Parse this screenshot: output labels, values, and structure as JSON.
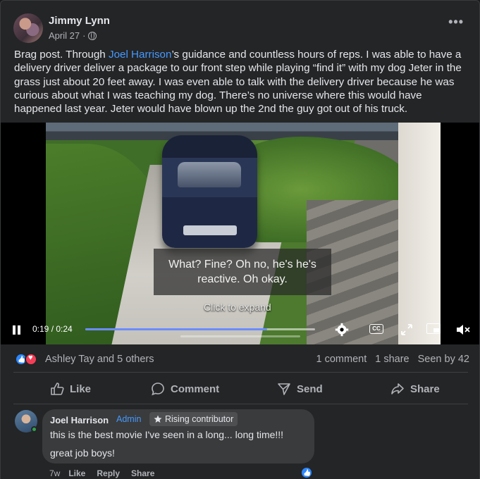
{
  "post": {
    "author": "Jimmy Lynn",
    "date": "April 27",
    "date_separator": "·",
    "text_before_mention": "Brag post. Through ",
    "mention": "Joel Harrison",
    "text_after_mention": "’s guidance and countless hours of reps. I was able to have a delivery driver deliver a package to our front step while playing “find it” with my dog Jeter in the grass just about 20 feet away. I was even able to talk with the delivery driver because he was curious about what I was teaching my dog. There’s no universe where this would have happened last year. Jeter would have blown up the 2nd the guy got out of his truck.",
    "more_icon": "more-horizontal-icon",
    "privacy_icon": "globe-icon"
  },
  "video": {
    "subtitle_line1": "What? Fine? Oh no, he's he's",
    "subtitle_line2": "reactive. Oh okay.",
    "expand_hint": "Click to expand",
    "current_time": "0:19",
    "time_separator": " / ",
    "duration": "0:24",
    "progress_fraction": 0.79,
    "cc_label": "CC",
    "accent_color": "#6c8cff"
  },
  "reactions": {
    "names": "Ashley Tay and 5 others",
    "comments": "1 comment",
    "shares": "1 share",
    "seen_by": "Seen by 42"
  },
  "actions": {
    "like": "Like",
    "comment": "Comment",
    "send": "Send",
    "share": "Share"
  },
  "comment": {
    "author": "Joel Harrison",
    "role": "Admin",
    "badge": "Rising contributor",
    "line1": "this is the best movie I've seen in a long... long time!!!",
    "line2": "great job boys!",
    "time_ago": "7w",
    "like": "Like",
    "reply": "Reply",
    "share": "Share"
  },
  "colors": {
    "background": "#242526",
    "link": "#4599ff",
    "like_blue": "#2d88ff",
    "love_red": "#f33e58"
  }
}
